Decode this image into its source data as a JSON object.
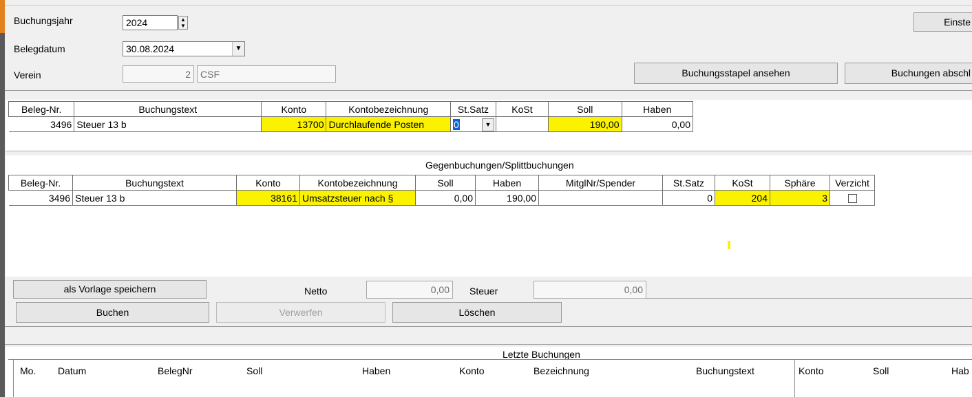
{
  "header": {
    "buchungsjahr_label": "Buchungsjahr",
    "buchungsjahr_value": "2024",
    "belegdatum_label": "Belegdatum",
    "belegdatum_value": "30.08.2024",
    "verein_label": "Verein",
    "verein_nr": "2",
    "verein_name": "CSF",
    "btn_einstellungen": "Einste",
    "btn_stapel": "Buchungsstapel ansehen",
    "btn_abschliessen": "Buchungen abschl"
  },
  "main_grid": {
    "columns": [
      "Beleg-Nr.",
      "Buchungstext",
      "Konto",
      "Kontobezeichnung",
      "St.Satz",
      "KoSt",
      "Soll",
      "Haben"
    ],
    "row": {
      "beleg": "3496",
      "text": "Steuer 13 b",
      "konto": "13700",
      "bezeichnung": "Durchlaufende Posten",
      "stsatz": "0",
      "kost": "",
      "soll": "190,00",
      "haben": "0,00"
    }
  },
  "split_grid": {
    "title": "Gegenbuchungen/Splittbuchungen",
    "columns": [
      "Beleg-Nr.",
      "Buchungstext",
      "Konto",
      "Kontobezeichnung",
      "Soll",
      "Haben",
      "MitglNr/Spender",
      "St.Satz",
      "KoSt",
      "Sphäre",
      "Verzicht"
    ],
    "row": {
      "beleg": "3496",
      "text": "Steuer 13 b",
      "konto": "38161",
      "bezeichnung": "Umsatzsteuer nach §",
      "soll": "0,00",
      "haben": "190,00",
      "mitgl": "",
      "stsatz": "0",
      "kost": "204",
      "sphaere": "3"
    }
  },
  "actions": {
    "vorlage": "als Vorlage speichern",
    "netto_label": "Netto",
    "netto_value": "0,00",
    "steuer_label": "Steuer",
    "steuer_value": "0,00",
    "buchen": "Buchen",
    "verwerfen": "Verwerfen",
    "loeschen": "Löschen"
  },
  "recent": {
    "title": "Letzte Buchungen",
    "columns": [
      "Mo.",
      "Datum",
      "BelegNr",
      "Soll",
      "Haben",
      "Konto",
      "Bezeichnung",
      "Buchungstext",
      "Konto",
      "Soll",
      "Hab"
    ]
  },
  "colors": {
    "highlight": "#fbf200",
    "background": "#f0f0f0"
  }
}
